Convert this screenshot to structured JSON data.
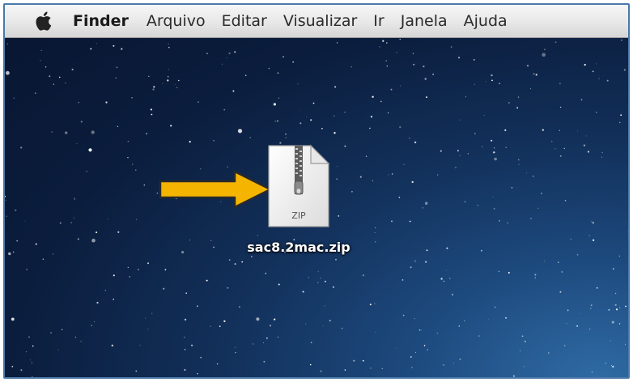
{
  "menubar": {
    "apple_icon": "apple-logo-icon",
    "app_name": "Finder",
    "items": [
      "Arquivo",
      "Editar",
      "Visualizar",
      "Ir",
      "Janela",
      "Ajuda"
    ]
  },
  "desktop": {
    "arrow_icon": "yellow-arrow-right-icon",
    "arrow_color": "#f5b400",
    "file": {
      "name": "sac8.2mac.zip",
      "icon": "zip-archive-icon",
      "badge": "ZIP"
    }
  },
  "colors": {
    "wallpaper_dark": "#0b1d3d",
    "wallpaper_glow": "#2f6aa4",
    "frame_border": "#4a78a8"
  }
}
